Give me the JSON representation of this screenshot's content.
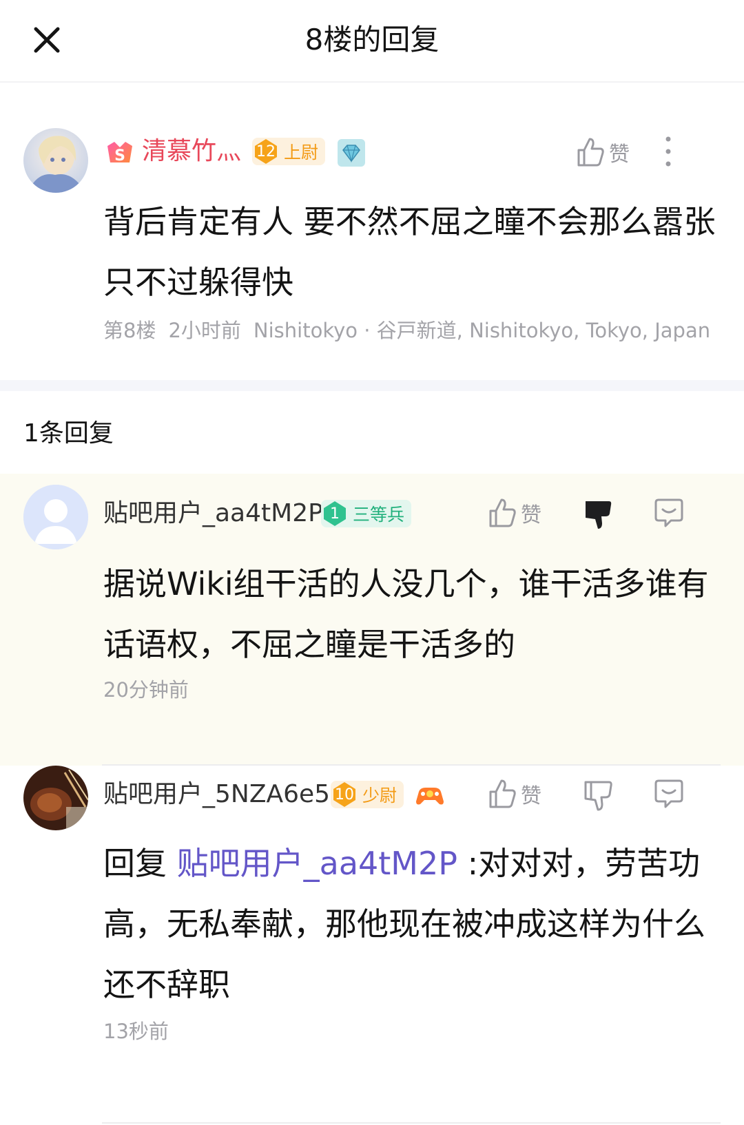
{
  "header": {
    "title": "8楼的回复",
    "close_icon": "close-icon"
  },
  "main_post": {
    "username": "清慕竹灬",
    "level_num": "12",
    "level_title": "上尉",
    "like_label": "赞",
    "text": "背后肯定有人 要不然不屈之瞳不会那么嚣张 只不过躲得快",
    "floor": "第8楼",
    "time": "2小时前",
    "location": "Nishitokyo · 谷戸新道, Nishitokyo, Tokyo, Japan"
  },
  "replies_header": {
    "count_label": "1条回复"
  },
  "replies": [
    {
      "username": "贴吧用户_aa4tM2P",
      "level_num": "1",
      "level_title": "三等兵",
      "like_label": "赞",
      "text": "据说Wiki组干活的人没几个，谁干活多谁有话语权，不屈之瞳是干活多的",
      "time": "20分钟前"
    },
    {
      "username": "贴吧用户_5NZA6e5",
      "level_num": "10",
      "level_title": "少尉",
      "like_label": "赞",
      "reply_prefix": "回复 ",
      "mention": "贴吧用户_aa4tM2P",
      "text": " :对对对，劳苦功高，无私奉献，那他现在被冲成这样为什么还不辞职",
      "time": "13秒前"
    }
  ],
  "colors": {
    "username_vip": "#e8485a",
    "mention": "#6356c8",
    "meta": "#a3a3a8",
    "reply_highlight_bg": "#fcfbf2",
    "badge_orange": "#f6a319",
    "badge_green": "#2fc28f"
  }
}
